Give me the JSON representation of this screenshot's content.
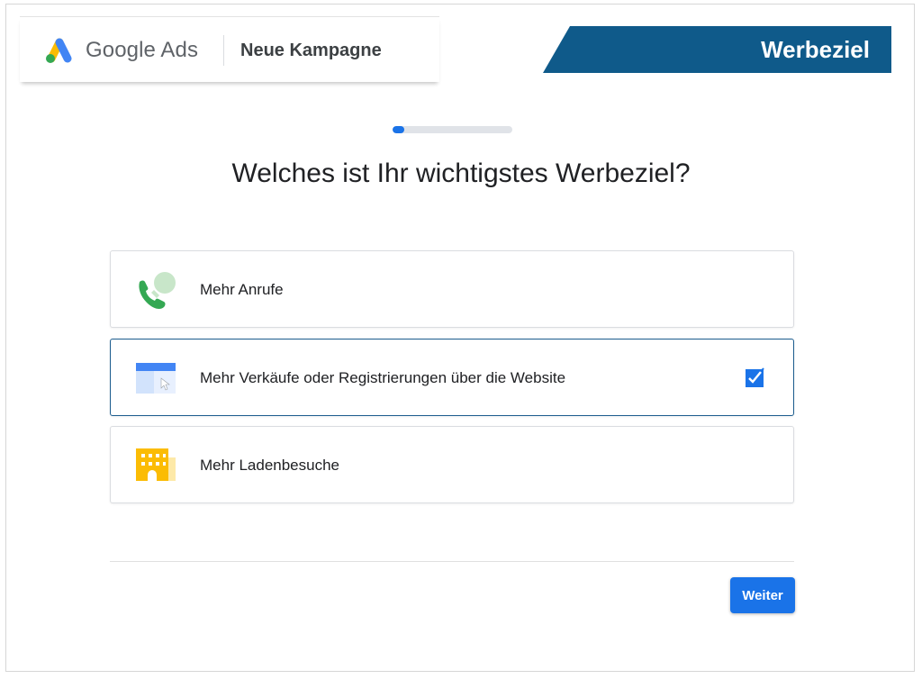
{
  "header": {
    "brand_name": "Google Ads",
    "campaign_title": "Neue Kampagne",
    "ribbon_label": "Werbeziel"
  },
  "progress": {
    "fraction": 0.1
  },
  "question": "Welches ist Ihr wichtigstes Werbeziel?",
  "options": [
    {
      "label": "Mehr Anrufe",
      "icon": "phone-call-icon",
      "selected": false
    },
    {
      "label": "Mehr Verkäufe oder Registrierungen über die Website",
      "icon": "website-click-icon",
      "selected": true
    },
    {
      "label": "Mehr Ladenbesuche",
      "icon": "store-building-icon",
      "selected": false
    }
  ],
  "footer": {
    "next_label": "Weiter"
  },
  "colors": {
    "accent": "#1a73e8",
    "ribbon": "#0f5a8a",
    "selected_border": "#1c5c8e"
  }
}
